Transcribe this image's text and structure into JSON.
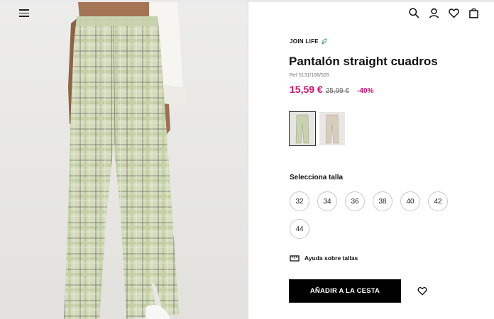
{
  "header": {
    "menu_icon": "hamburger-menu-icon",
    "icons": [
      "search-icon",
      "user-icon",
      "heart-icon",
      "bag-icon"
    ]
  },
  "product": {
    "brand_tag": "JOIN LIFE",
    "title": "Pantalón straight cuadros",
    "ref": "Ref 5131/168/526",
    "price_current": "15,59 €",
    "price_old": "25,99 €",
    "discount": "-40%"
  },
  "colors": {
    "swatches": [
      "green-check",
      "beige-check"
    ],
    "selected": "green-check"
  },
  "sizes": {
    "label": "Selecciona talla",
    "options": [
      "32",
      "34",
      "36",
      "38",
      "40",
      "42",
      "44"
    ]
  },
  "size_help": {
    "label": "Ayuda sobre tallas"
  },
  "cta": {
    "add_label": "AÑADIR A LA CESTA"
  },
  "palette": {
    "accent": "#d0106f",
    "button_bg": "#000000"
  }
}
